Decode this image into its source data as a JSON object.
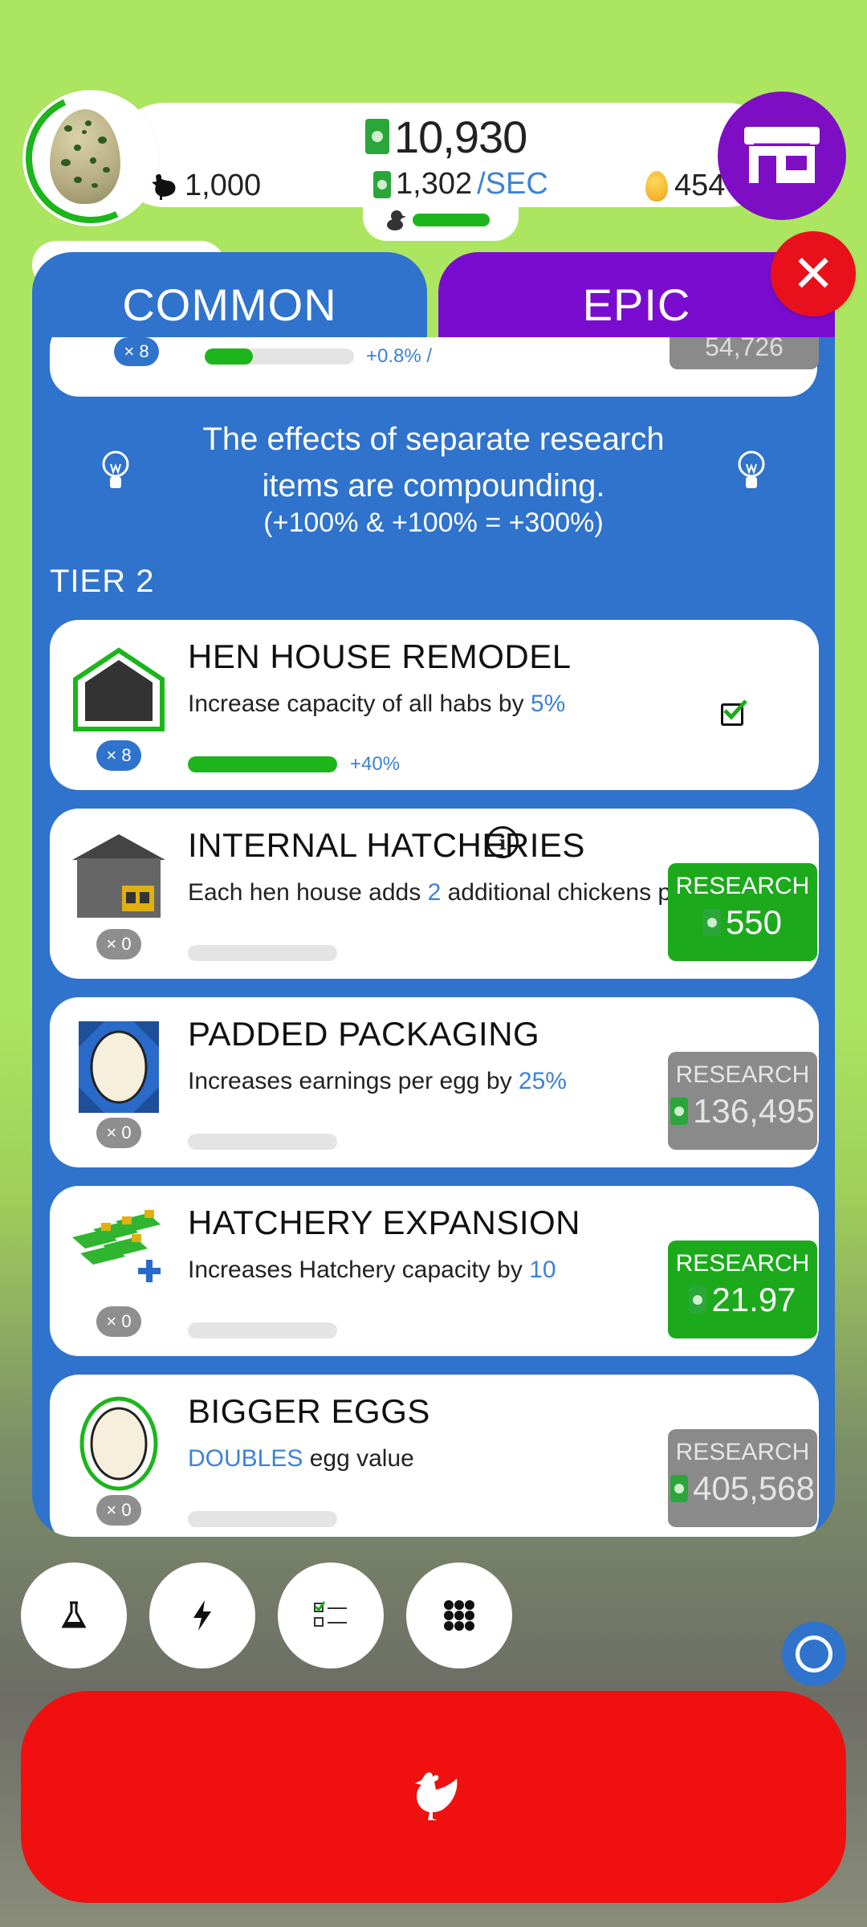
{
  "hud": {
    "money": "10,930",
    "rate_value": "1,302",
    "rate_unit": "/SEC",
    "chicken_count": "1,000",
    "golden_eggs": "454"
  },
  "tabs": [
    {
      "label": "COMMON",
      "color": "#2f73cc",
      "active": true
    },
    {
      "label": "EPIC",
      "color": "#7a0ccf",
      "active": false
    }
  ],
  "partial_card": {
    "count": "× 8",
    "percent": "+0.8% /",
    "price": "54,726",
    "progress": 0.32
  },
  "tip": {
    "text": "The effects of separate research items are compounding.",
    "formula": "(+100% & +100% = +300%)"
  },
  "tier_label": "TIER 2",
  "research_items": [
    {
      "title": "HEN HOUSE REMODEL",
      "desc_prefix": "Increase capacity of all habs by ",
      "desc_highlight": "5%",
      "desc_suffix": "",
      "count": "× 8",
      "progress": 1.0,
      "bar_pct": "+40%",
      "completed": true,
      "icon": "hen-house-icon"
    },
    {
      "title": "INTERNAL HATCHERIES",
      "desc_prefix": "Each hen house adds ",
      "desc_highlight": "2",
      "desc_suffix": " additional chickens per minute",
      "count": "× 0",
      "progress": 0,
      "button_label": "RESEARCH",
      "price": "550",
      "affordable": true,
      "icon": "internal-hatchery-icon"
    },
    {
      "title": "PADDED PACKAGING",
      "desc_prefix": "Increases earnings per egg by ",
      "desc_highlight": "25%",
      "desc_suffix": "",
      "count": "× 0",
      "progress": 0,
      "button_label": "RESEARCH",
      "price": "136,495",
      "affordable": false,
      "icon": "padded-egg-icon"
    },
    {
      "title": "HATCHERY EXPANSION",
      "desc_prefix": "Increases Hatchery capacity by ",
      "desc_highlight": "10",
      "desc_suffix": "",
      "count": "× 0",
      "progress": 0,
      "button_label": "RESEARCH",
      "price": "21.97",
      "affordable": true,
      "icon": "hatchery-expansion-icon"
    },
    {
      "title": "BIGGER EGGS",
      "desc_prefix": "",
      "desc_highlight": "DOUBLES",
      "desc_suffix": " egg value",
      "count": "× 0",
      "progress": 0,
      "button_label": "RESEARCH",
      "price": "405,568",
      "affordable": false,
      "icon": "bigger-egg-icon"
    }
  ],
  "bottom_buttons": [
    "flask-icon",
    "lightning-icon",
    "checklist-icon",
    "grid-icon"
  ],
  "colors": {
    "background": "#ace660",
    "panel": "#2f73cc",
    "accent_green": "#1caa1c",
    "hatch_button": "#f0100f",
    "shop_button": "#7e0ec4",
    "close_button": "#e8111b"
  }
}
